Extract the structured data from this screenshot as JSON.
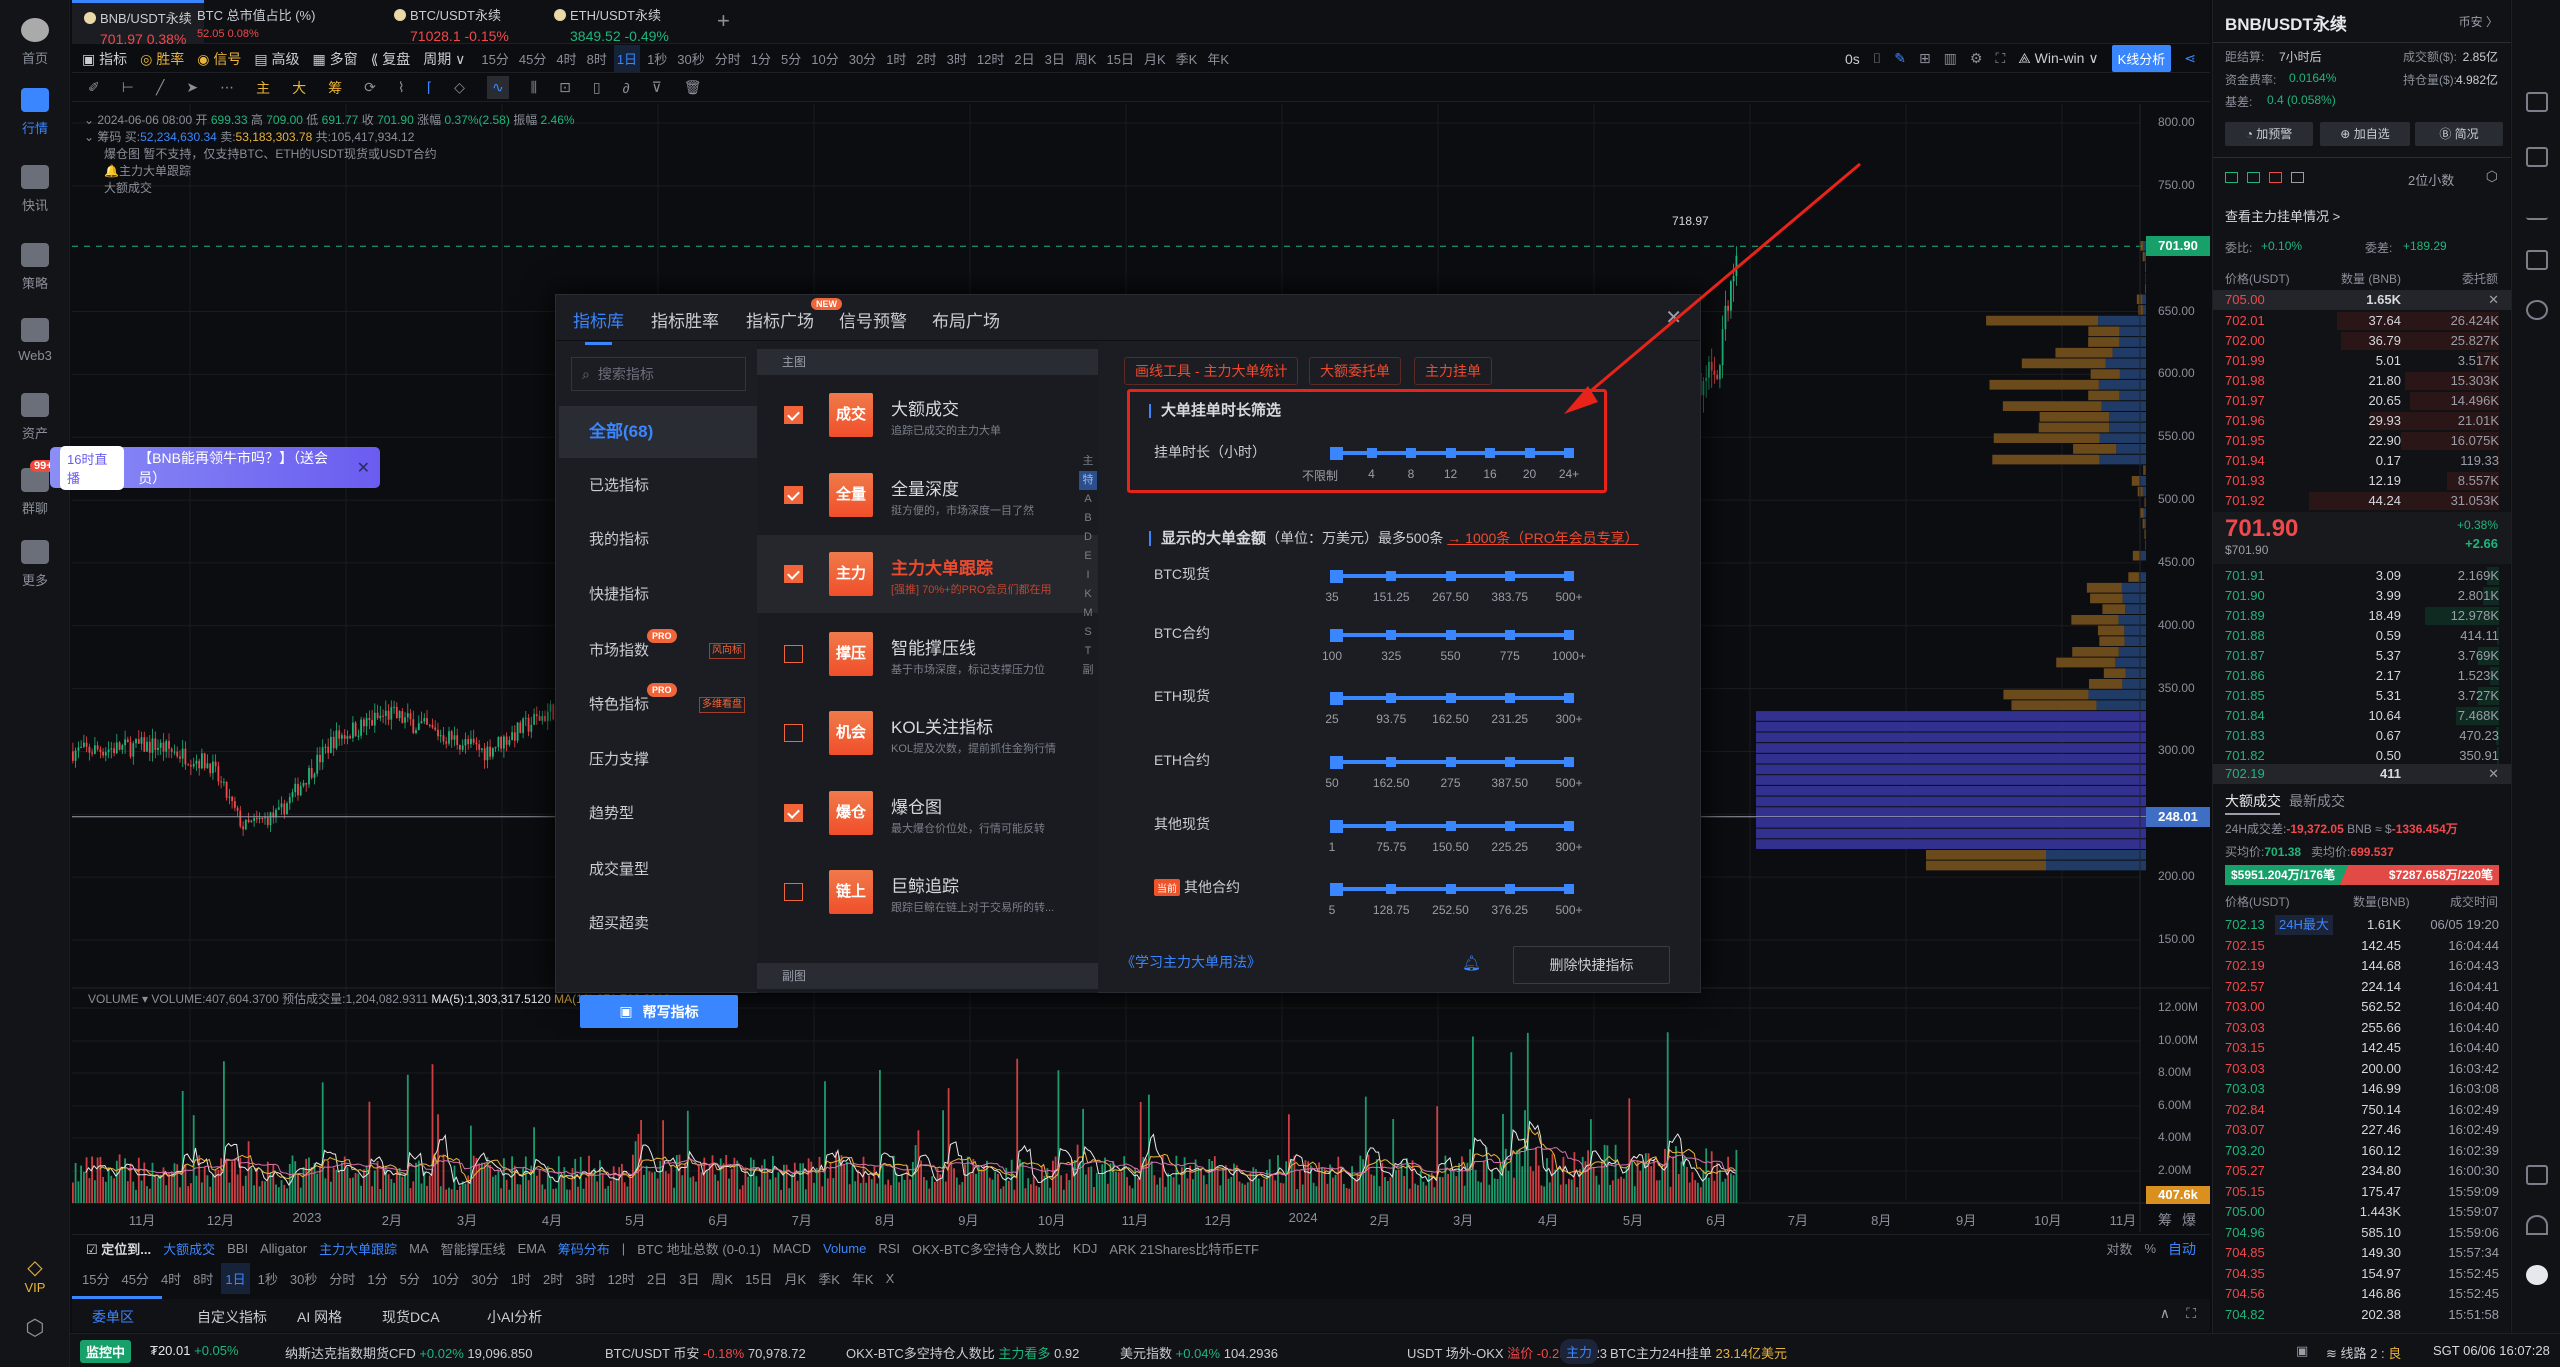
{
  "nav": {
    "items": [
      {
        "label": "首页",
        "icon": "logo-icon"
      },
      {
        "label": "行情",
        "icon": "bar-chart-icon",
        "active": true
      },
      {
        "label": "快讯",
        "icon": "news-icon"
      },
      {
        "label": "策略",
        "icon": "robot-icon"
      },
      {
        "label": "Web3",
        "icon": "web3-icon"
      },
      {
        "label": "资产",
        "icon": "wallet-icon"
      },
      {
        "label": "群聊",
        "icon": "chat-icon",
        "badge": "99+"
      },
      {
        "label": "更多",
        "icon": "more-grid-icon"
      }
    ],
    "vip": "VIP"
  },
  "tabs": [
    {
      "name": "BNB/USDT永续",
      "price": "701.97",
      "change": "0.38%",
      "dir": "up",
      "active": true
    },
    {
      "name": "BTC 总市值占比 (%)",
      "price": "52.05",
      "change": "0.08%",
      "dir": "up"
    },
    {
      "name": "BTC/USDT永续",
      "price": "71028.1",
      "change": "-0.15%",
      "dir": "up"
    },
    {
      "name": "ETH/USDT永续",
      "price": "3849.52",
      "change": "-0.49%",
      "dir": "down"
    }
  ],
  "toolbar": {
    "indicator": "指标",
    "winrate": "胜率",
    "signal": "信号",
    "advanced": "高级",
    "multiwin": "多窗",
    "replay": "复盘",
    "period": "周期",
    "intervals": [
      "15分",
      "45分",
      "4时",
      "8时",
      "1日",
      "1秒",
      "30秒",
      "分时",
      "1分",
      "5分",
      "10分",
      "30分",
      "1时",
      "2时",
      "3时",
      "12时",
      "2日",
      "3日",
      "周K",
      "15日",
      "月K",
      "季K",
      "年K"
    ],
    "active_interval": "1日",
    "timer": "0s",
    "winwin": "Win-win",
    "kline_analysis": "K线分析",
    "draw_labels": [
      "主",
      "大",
      "筹"
    ]
  },
  "chart_info": {
    "date": "2024-06-06 08:00",
    "open_l": "开",
    "open": "699.33",
    "high_l": "高",
    "high": "709.00",
    "low_l": "低",
    "low": "691.77",
    "close_l": "收",
    "close": "701.90",
    "chg_l": "涨幅",
    "chg": "0.37%(2.58)",
    "amp_l": "振幅",
    "amp": "2.46%",
    "chip_l": "筹码",
    "buy_l": "买:",
    "buy": "52,234,630.34",
    "sell_l": "卖:",
    "sell": "53,183,303.78",
    "total_l": "共:",
    "total": "105,417,934.12",
    "liq": "爆仓图 暂不支持，仅支持BTC、ETH的USDT现货或USDT合约",
    "whale": "主力大单跟踪",
    "big": "大额成交"
  },
  "price_axis": [
    "800.00",
    "750.00",
    "650.00",
    "600.00",
    "550.00",
    "500.00",
    "450.00",
    "400.00",
    "350.00",
    "300.00",
    "200.00",
    "150.00"
  ],
  "price_tags": {
    "last": "701.90",
    "line": "248.01",
    "high_mark": "718.97",
    "vol_last": "407.6k"
  },
  "volume": {
    "title": "VOLUME",
    "value": "VOLUME:407,604.3700",
    "est": "预估成交量:1,204,082.9311",
    "ma5": "MA(5):1,303,317.5120",
    "ma10": "MA(10):871,702.8910",
    "axis": [
      "12.00M",
      "10.00M",
      "8.00M",
      "6.00M",
      "4.00M",
      "2.00M"
    ]
  },
  "x_axis": [
    "11月",
    "12月",
    "2023",
    "2月",
    "3月",
    "4月",
    "5月",
    "6月",
    "7月",
    "8月",
    "9月",
    "10月",
    "11月",
    "12月",
    "2024",
    "2月",
    "3月",
    "4月",
    "5月",
    "6月",
    "7月",
    "8月",
    "9月",
    "10月",
    "11月"
  ],
  "x_axis_right": [
    "筹",
    "爆"
  ],
  "banner": {
    "pill": "16时直播",
    "text": "【BNB能再领牛市吗？】（送会员）"
  },
  "modal": {
    "tabs": [
      "指标库",
      "指标胜率",
      "指标广场",
      "信号预警",
      "布局广场"
    ],
    "new_badge": "NEW",
    "search_placeholder": "搜索指标",
    "categories": [
      {
        "label": "全部(68)",
        "active": true
      },
      {
        "label": "已选指标"
      },
      {
        "label": "我的指标"
      },
      {
        "label": "快捷指标"
      },
      {
        "label": "市场指数",
        "pro": "PRO",
        "sub": "风向标"
      },
      {
        "label": "特色指标",
        "pro": "PRO",
        "sub": "多维看盘"
      },
      {
        "label": "压力支撑"
      },
      {
        "label": "趋势型"
      },
      {
        "label": "成交量型"
      },
      {
        "label": "超买超卖"
      }
    ],
    "help_button": "帮写指标",
    "main_header": "主图",
    "sub_header": "副图",
    "indicators": [
      {
        "badge": "成交",
        "title": "大额成交",
        "desc": "追踪已成交的主力大单",
        "checked": true
      },
      {
        "badge": "全量",
        "title": "全量深度",
        "desc": "挺方便的，市场深度一目了然",
        "checked": true
      },
      {
        "badge": "主力",
        "title": "主力大单跟踪",
        "desc": "[强推] 70%+的PRO会员们都在用",
        "checked": true,
        "highlight": true
      },
      {
        "badge": "撑压",
        "title": "智能撑压线",
        "desc": "基于市场深度，标记支撑压力位",
        "checked": false
      },
      {
        "badge": "机会",
        "title": "KOL关注指标",
        "desc": "KOL提及次数，提前抓住金狗行情",
        "checked": false
      },
      {
        "badge": "爆仓",
        "title": "爆仓图",
        "desc": "最大爆仓价位处，行情可能反转",
        "checked": true
      },
      {
        "badge": "链上",
        "title": "巨鲸追踪",
        "desc": "跟踪巨鲸在链上对于交易所的转...",
        "checked": false
      }
    ],
    "letters": [
      "主",
      "特",
      "A",
      "B",
      "D",
      "E",
      "I",
      "K",
      "M",
      "S",
      "T",
      "副"
    ],
    "active_letter": "特",
    "tags": [
      "画线工具 - 主力大单统计",
      "大额委托单",
      "主力挂单"
    ],
    "duration": {
      "title": "大单挂单时长筛选",
      "label": "挂单时长（小时）",
      "ticks": [
        "不限制",
        "4",
        "8",
        "12",
        "16",
        "20",
        "24+"
      ]
    },
    "amount": {
      "title": "显示的大单金额",
      "unit": "（单位：万美元）最多500条",
      "upsell": "→ 1000条（PRO年会员专享）",
      "current": "当前",
      "rows": [
        {
          "label": "BTC现货",
          "ticks": [
            "35",
            "151.25",
            "267.50",
            "383.75",
            "500+"
          ]
        },
        {
          "label": "BTC合约",
          "ticks": [
            "100",
            "325",
            "550",
            "775",
            "1000+"
          ]
        },
        {
          "label": "ETH现货",
          "ticks": [
            "25",
            "93.75",
            "162.50",
            "231.25",
            "300+"
          ]
        },
        {
          "label": "ETH合约",
          "ticks": [
            "50",
            "162.50",
            "275",
            "387.50",
            "500+"
          ]
        },
        {
          "label": "其他现货",
          "ticks": [
            "1",
            "75.75",
            "150.50",
            "225.25",
            "300+"
          ]
        },
        {
          "label": "其他合约",
          "ticks": [
            "5",
            "128.75",
            "252.50",
            "376.25",
            "500+"
          ],
          "current": true
        }
      ]
    },
    "learn_link": "《学习主力大单用法》",
    "delete_button": "删除快捷指标"
  },
  "indicator_bar": {
    "locate": "定位到...",
    "items": [
      {
        "l": "大额成交",
        "on": true
      },
      {
        "l": "BBI"
      },
      {
        "l": "Alligator"
      },
      {
        "l": "主力大单跟踪",
        "on": true
      },
      {
        "l": "MA"
      },
      {
        "l": "智能撑压线"
      },
      {
        "l": "EMA"
      },
      {
        "l": "筹码分布",
        "on": true
      },
      {
        "l": "|"
      },
      {
        "l": "BTC 地址总数 (0-0.1)"
      },
      {
        "l": "MACD"
      },
      {
        "l": "Volume",
        "on": true
      },
      {
        "l": "RSI"
      },
      {
        "l": "OKX-BTC多空持仓人数比"
      },
      {
        "l": "KDJ"
      },
      {
        "l": "ARK 21Shares比特币ETF"
      }
    ],
    "right": [
      "对数",
      "%",
      "自动"
    ]
  },
  "bottom_intervals": [
    "15分",
    "45分",
    "4时",
    "8时",
    "1日",
    "1秒",
    "30秒",
    "分时",
    "1分",
    "5分",
    "10分",
    "30分",
    "1时",
    "2时",
    "3时",
    "12时",
    "2日",
    "3日",
    "周K",
    "15日",
    "月K",
    "季K",
    "年K",
    "X"
  ],
  "bottom_tabs": [
    "委单区",
    "自定义指标",
    "AI 网格",
    "现货DCA",
    "小AI分析"
  ],
  "ticker": {
    "monitor": "监控中",
    "usdt": "₮20.01",
    "usdt_chg": "+0.05%",
    "nasdaq": "纳斯达克指数期货CFD",
    "nasdaq_chg": "+0.02%",
    "nasdaq_v": "19,096.850",
    "btc": "BTC/USDT 币安",
    "btc_chg": "-0.18%",
    "btc_v": "70,978.72",
    "okx": "OKX-BTC多空持仓人数比",
    "okx_s": "主力看多",
    "okx_v": "0.92",
    "dxy": "美元指数",
    "dxy_chg": "+0.04%",
    "dxy_v": "104.2936",
    "otc": "USDT 场外-OKX",
    "otc_s": "溢价 -0.23%",
    "otc_v": "7.23",
    "main_tag": "主力",
    "main_text": "BTC主力24H挂单",
    "main_v": "23.14亿美元",
    "line": "线路 2 : ",
    "line_q": "良",
    "time": "SGT  06/06 16:07:28"
  },
  "right_panel": {
    "title": "BNB/USDT永续",
    "exchange": "币安 〉",
    "settle_l": "距结算:",
    "settle": "7小时后",
    "turnover_l": "成交额($):",
    "turnover": "2.85亿",
    "funding_l": "资金费率:",
    "funding": "0.0164%",
    "oi_l": "持仓量($):",
    "oi": "4.982亿",
    "basis_l": "基差:",
    "basis": "0.4 (0.058%)",
    "buttons": [
      "加预警",
      "加自选",
      "简况"
    ],
    "decimals": "2位小数",
    "whale_link": "查看主力挂单情况 >",
    "ratio_l": "委比:",
    "ratio": "+0.10%",
    "diff_l": "委差:",
    "diff": "+189.29",
    "headers": [
      "价格(USDT)",
      "数量 (BNB)",
      "委托额"
    ],
    "top_ask": [
      "705.00",
      "1.65K"
    ],
    "asks": [
      [
        "702.01",
        "37.64",
        "26.424K"
      ],
      [
        "702.00",
        "36.79",
        "25.827K"
      ],
      [
        "701.99",
        "5.01",
        "3.517K"
      ],
      [
        "701.98",
        "21.80",
        "15.303K"
      ],
      [
        "701.97",
        "20.65",
        "14.496K"
      ],
      [
        "701.96",
        "29.93",
        "21.01K"
      ],
      [
        "701.95",
        "22.90",
        "16.075K"
      ],
      [
        "701.94",
        "0.17",
        "119.33"
      ],
      [
        "701.93",
        "12.19",
        "8.557K"
      ],
      [
        "701.92",
        "44.24",
        "31.053K"
      ]
    ],
    "mid": "701.90",
    "mid_usd": "$701.90",
    "mid_pct": "+0.38%",
    "mid_chg": "+2.66",
    "bids": [
      [
        "701.91",
        "3.09",
        "2.169K"
      ],
      [
        "701.90",
        "3.99",
        "2.801K"
      ],
      [
        "701.89",
        "18.49",
        "12.978K"
      ],
      [
        "701.88",
        "0.59",
        "414.11"
      ],
      [
        "701.87",
        "5.37",
        "3.769K"
      ],
      [
        "701.86",
        "2.17",
        "1.523K"
      ],
      [
        "701.85",
        "5.31",
        "3.727K"
      ],
      [
        "701.84",
        "10.64",
        "7.468K"
      ],
      [
        "701.83",
        "0.67",
        "470.23"
      ],
      [
        "701.82",
        "0.50",
        "350.91"
      ]
    ],
    "bottom_bid": [
      "702.19",
      "411"
    ],
    "trade_tabs": [
      "大额成交",
      "最新成交"
    ],
    "diff24_l": "24H成交差:",
    "diff24": "-19,372.05",
    "diff24_u": "BNB ≈ $",
    "diff24_usd": "-1336.454万",
    "buyavg_l": "买均价:",
    "buyavg": "701.38",
    "sellavg_l": "卖均价:",
    "sellavg": "699.537",
    "buy_bar": "$5951.204万/176笔",
    "sell_bar": "$7287.658万/220笔",
    "buy_share": 0.45,
    "trade_headers": [
      "价格(USDT)",
      "数量(BNB)",
      "成交时间"
    ],
    "max_tag": "24H最大",
    "trades": [
      [
        "702.13",
        "1.61K",
        "06/05 19:20",
        "g"
      ],
      [
        "702.15",
        "142.45",
        "16:04:44",
        "r"
      ],
      [
        "702.19",
        "144.68",
        "16:04:43",
        "r"
      ],
      [
        "702.57",
        "224.14",
        "16:04:41",
        "r"
      ],
      [
        "703.00",
        "562.52",
        "16:04:40",
        "r"
      ],
      [
        "703.03",
        "255.66",
        "16:04:40",
        "r"
      ],
      [
        "703.15",
        "142.45",
        "16:04:40",
        "r"
      ],
      [
        "703.03",
        "200.00",
        "16:03:42",
        "r"
      ],
      [
        "703.03",
        "146.99",
        "16:03:08",
        "g"
      ],
      [
        "702.84",
        "750.14",
        "16:02:49",
        "r"
      ],
      [
        "703.07",
        "227.46",
        "16:02:49",
        "r"
      ],
      [
        "703.20",
        "160.12",
        "16:02:39",
        "g"
      ],
      [
        "705.27",
        "234.80",
        "16:00:30",
        "r"
      ],
      [
        "705.15",
        "175.47",
        "15:59:09",
        "r"
      ],
      [
        "705.00",
        "1.443K",
        "15:59:07",
        "g"
      ],
      [
        "704.96",
        "585.10",
        "15:59:06",
        "g"
      ],
      [
        "704.85",
        "149.30",
        "15:57:34",
        "r"
      ],
      [
        "704.35",
        "154.97",
        "15:52:45",
        "r"
      ],
      [
        "704.56",
        "146.86",
        "15:52:45",
        "r"
      ],
      [
        "704.82",
        "202.38",
        "15:51:58",
        "g"
      ]
    ]
  },
  "colors": {
    "up": "#1fb57c",
    "down": "#f0494c",
    "accent": "#3a86ff",
    "warn": "#f0653a",
    "highlight_box": "#e8231a"
  }
}
